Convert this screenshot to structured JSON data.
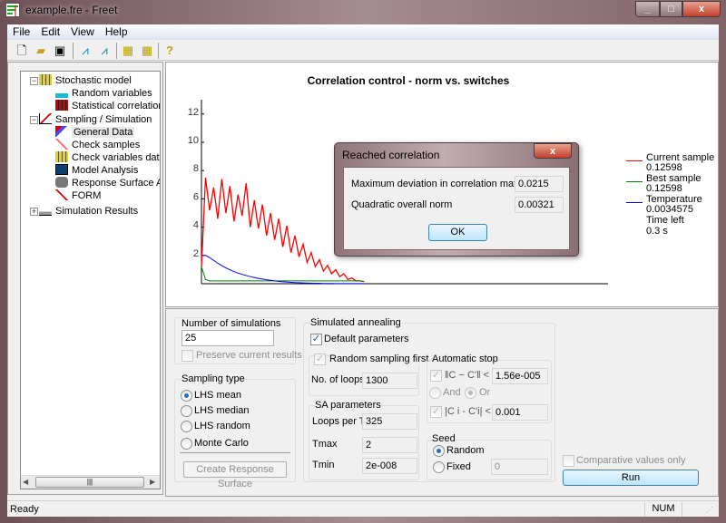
{
  "window": {
    "title": "example.fre - Freet",
    "minimize": "_",
    "maximize": "□",
    "close": "x"
  },
  "menu": [
    {
      "label": "File"
    },
    {
      "label": "Edit"
    },
    {
      "label": "View"
    },
    {
      "label": "Help"
    }
  ],
  "toolbar": [
    {
      "icon": "new-file-icon"
    },
    {
      "icon": "open-folder-icon"
    },
    {
      "icon": "save-icon"
    },
    {
      "icon": "random-variable-icon"
    },
    {
      "icon": "random-variable-edit-icon"
    },
    {
      "icon": "table-icon"
    },
    {
      "icon": "table-edit-icon"
    },
    {
      "icon": "help-icon"
    }
  ],
  "tree": {
    "stochastic": "Stochastic model",
    "random_variables": "Random variables",
    "statistical_correlation": "Statistical correlation",
    "sampling": "Sampling / Simulation",
    "general_data": "General Data",
    "check_samples": "Check samples",
    "check_variables": "Check variables data",
    "model_analysis": "Model Analysis",
    "response_surface": "Response Surface Ar",
    "form": "FORM",
    "results": "Simulation Results",
    "selected": "General Data"
  },
  "chart_data": {
    "type": "line",
    "title": "Correlation control - norm vs. switches",
    "xlabel": "",
    "ylabel": "",
    "ylim": [
      0,
      12.5
    ],
    "xlim": [
      0,
      100
    ],
    "yticks": [
      "2",
      "4",
      "6",
      "8",
      "10",
      "12"
    ],
    "grid": false,
    "legend_placement": "right",
    "x": [
      0,
      1,
      2,
      3,
      4,
      5,
      6,
      7,
      8,
      9,
      10,
      11,
      12,
      13,
      14,
      15,
      16,
      17,
      18,
      19,
      20,
      21,
      22,
      23,
      24,
      25,
      26,
      27,
      28,
      29,
      30,
      31,
      32,
      33,
      34,
      35,
      36,
      37,
      38,
      39,
      40
    ],
    "series": [
      {
        "name": "Current sample",
        "color": "#ff0000",
        "values": [
          1.2,
          7.5,
          5.2,
          6.8,
          4.6,
          7.4,
          5.0,
          6.9,
          4.4,
          6.3,
          4.8,
          7.1,
          4.0,
          5.9,
          3.9,
          5.6,
          3.4,
          5.0,
          3.1,
          4.6,
          2.6,
          4.1,
          2.2,
          3.4,
          1.9,
          2.8,
          1.5,
          2.2,
          1.2,
          1.7,
          0.9,
          1.3,
          0.7,
          1.0,
          0.5,
          0.7,
          0.3,
          0.4,
          0.2,
          0.2,
          0.15
        ]
      },
      {
        "name": "Best sample",
        "color": "#008000",
        "values": [
          1.2,
          0.3,
          0.2,
          0.2,
          0.2,
          0.2,
          0.2,
          0.2,
          0.2,
          0.2,
          0.2,
          0.2,
          0.2,
          0.2,
          0.2,
          0.2,
          0.2,
          0.2,
          0.2,
          0.2,
          0.2,
          0.2,
          0.2,
          0.2,
          0.2,
          0.2,
          0.2,
          0.2,
          0.2,
          0.2,
          0.2,
          0.2,
          0.2,
          0.2,
          0.2,
          0.2,
          0.2,
          0.2,
          0.2,
          0.2,
          0.15
        ]
      },
      {
        "name": "Temperature",
        "color": "#0000ff",
        "values": [
          2.0,
          2.0,
          1.85,
          1.65,
          1.45,
          1.28,
          1.12,
          0.98,
          0.86,
          0.75,
          0.66,
          0.58,
          0.5,
          0.44,
          0.38,
          0.33,
          0.28,
          0.24,
          0.2,
          0.17,
          0.14,
          0.12,
          0.1,
          0.08,
          0.07,
          0.06,
          0.05,
          0.04,
          0.03,
          0.03,
          0.02,
          0.02,
          0.02,
          0.01,
          0.01,
          0.01,
          0.01,
          0.01,
          0.01,
          0.01,
          0.01
        ]
      }
    ],
    "legend": {
      "current_label": "Current sample",
      "current_value": "0.12598",
      "best_label": "Best sample",
      "best_value": "0.12598",
      "temp_label": "Temperature",
      "temp_value": "0.0034575",
      "time_label": "Time left",
      "time_value": "0.3 s"
    }
  },
  "dialog": {
    "title": "Reached correlation",
    "close": "x",
    "max_dev_label": "Maximum deviation in correlation matrix",
    "max_dev_value": "0.0215",
    "quad_label": "Quadratic overall norm",
    "quad_value": "0.00321",
    "ok": "OK"
  },
  "settings": {
    "num_sim_label": "Number of simulations",
    "num_sim_value": "25",
    "preserve": "Preserve current results",
    "sampling_type_label": "Sampling type",
    "sampling_types": [
      "LHS mean",
      "LHS median",
      "LHS random",
      "Monte Carlo"
    ],
    "sampling_selected": "LHS mean",
    "create_rs": "Create Response Surface",
    "sa_label": "Simulated annealing",
    "default_params": "Default parameters",
    "default_params_checked": true,
    "random_first": "Random sampling first",
    "loops_label": "No. of loops",
    "loops_value": "1300",
    "sa_params_label": "SA parameters",
    "loops_per_t_label": "Loops per T",
    "loops_per_t_value": "325",
    "tmax_label": "Tmax",
    "tmax_value": "2",
    "tmin_label": "Tmin",
    "tmin_value": "2e-008",
    "auto_stop_label": "Automatic stop",
    "norm_label": "‖C − C'‖ <",
    "norm_value": "1.56e-005",
    "and": "And",
    "or": "Or",
    "or_selected": true,
    "elem_label": "|C i - C'i| <",
    "elem_value": "0.001",
    "seed_label": "Seed",
    "seed_random": "Random",
    "seed_fixed": "Fixed",
    "seed_value": "0",
    "seed_selected": "Random",
    "comparative": "Comparative values only",
    "run": "Run"
  },
  "status": {
    "text": "Ready",
    "num": "NUM"
  }
}
